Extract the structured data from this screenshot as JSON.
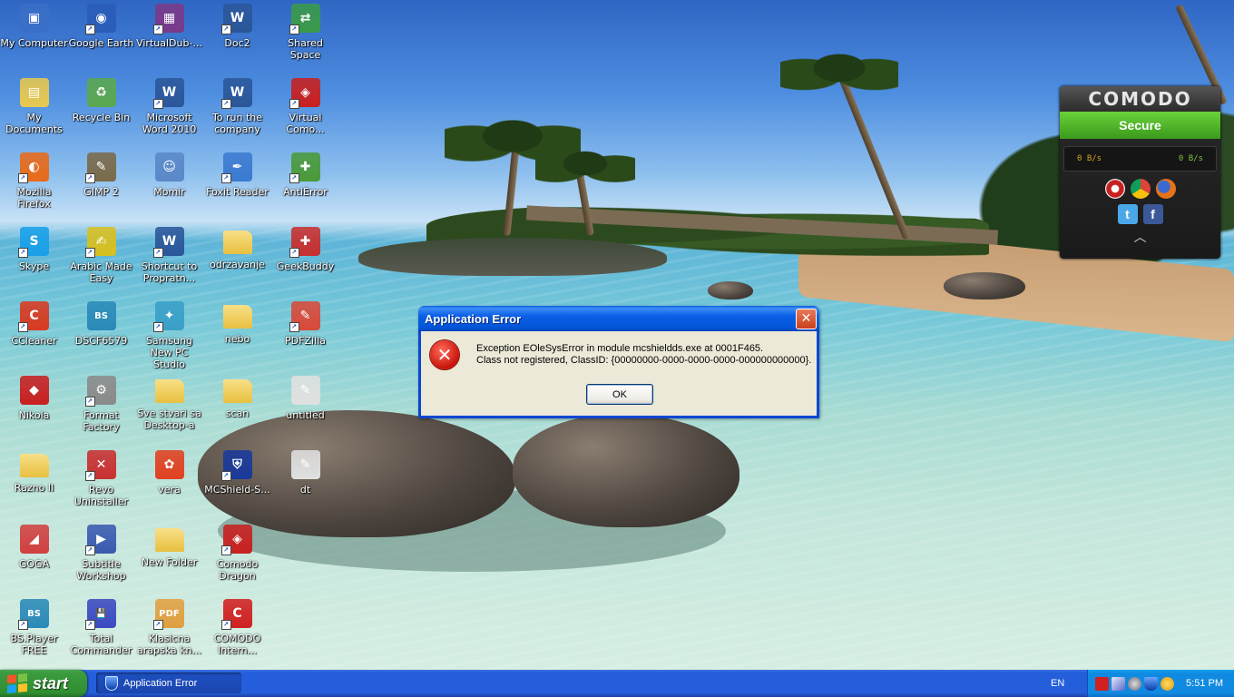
{
  "desktop": {
    "icons": [
      {
        "label": "My Computer",
        "icon": "my-computer-icon",
        "color": "#3a6fc8",
        "glyph": "▣",
        "shortcut": false
      },
      {
        "label": "Google Earth",
        "icon": "google-earth-icon",
        "color": "#2a5db8",
        "glyph": "◉",
        "shortcut": true
      },
      {
        "label": "VirtualDub-...",
        "icon": "virtualdub-icon",
        "color": "#7a3a8a",
        "glyph": "▦",
        "shortcut": true
      },
      {
        "label": "Doc2",
        "icon": "word-document-icon",
        "color": "#2b579a",
        "glyph": "W",
        "shortcut": true
      },
      {
        "label": "Shared Space",
        "icon": "shared-space-icon",
        "color": "#3a9a4a",
        "glyph": "⇄",
        "shortcut": true
      },
      {
        "label": "My Documents",
        "icon": "my-documents-icon",
        "color": "#e8c850",
        "glyph": "▤",
        "shortcut": false
      },
      {
        "label": "Recycle Bin",
        "icon": "recycle-bin-icon",
        "color": "#5aa850",
        "glyph": "♻",
        "shortcut": false
      },
      {
        "label": "Microsoft Word 2010",
        "icon": "word-icon",
        "color": "#2b579a",
        "glyph": "W",
        "shortcut": true
      },
      {
        "label": "To run the company",
        "icon": "word-document-icon",
        "color": "#2b579a",
        "glyph": "W",
        "shortcut": true
      },
      {
        "label": "Virtual Como...",
        "icon": "comodo-virtual-icon",
        "color": "#c82020",
        "glyph": "◈",
        "shortcut": true
      },
      {
        "label": "Mozilla Firefox",
        "icon": "firefox-icon",
        "color": "#e86a1a",
        "glyph": "◐",
        "shortcut": true
      },
      {
        "label": "GIMP 2",
        "icon": "gimp-icon",
        "color": "#7a6a4a",
        "glyph": "✎",
        "shortcut": true
      },
      {
        "label": "Momir",
        "icon": "user-folder-icon",
        "color": "#5a88c8",
        "glyph": "☺",
        "shortcut": false
      },
      {
        "label": "Foxit Reader",
        "icon": "foxit-reader-icon",
        "color": "#3a7ad0",
        "glyph": "✒",
        "shortcut": true
      },
      {
        "label": "AntiError",
        "icon": "antierror-icon",
        "color": "#4a9a3a",
        "glyph": "✚",
        "shortcut": true
      },
      {
        "label": "Skype",
        "icon": "skype-icon",
        "color": "#1aa0e8",
        "glyph": "S",
        "shortcut": true
      },
      {
        "label": "Arabic Made Easy",
        "icon": "arabic-made-easy-icon",
        "color": "#d8c020",
        "glyph": "✍",
        "shortcut": true
      },
      {
        "label": "Shortcut to Propratn...",
        "icon": "word-document-icon",
        "color": "#2b579a",
        "glyph": "W",
        "shortcut": true
      },
      {
        "label": "odrzavanje",
        "icon": "folder-icon",
        "color": "#f0d060",
        "glyph": "",
        "shortcut": false
      },
      {
        "label": "GeekBuddy",
        "icon": "geekbuddy-icon",
        "color": "#c83030",
        "glyph": "✚",
        "shortcut": true
      },
      {
        "label": "CCleaner",
        "icon": "ccleaner-icon",
        "color": "#d83a20",
        "glyph": "C",
        "shortcut": true
      },
      {
        "label": "DSCF6579",
        "icon": "bsplayer-file-icon",
        "color": "#2a8ab8",
        "glyph": "BS",
        "shortcut": false
      },
      {
        "label": "Samsung New PC Studio",
        "icon": "samsung-pc-studio-icon",
        "color": "#3aa0c8",
        "glyph": "✦",
        "shortcut": true
      },
      {
        "label": "nebo",
        "icon": "folder-icon",
        "color": "#f0d060",
        "glyph": "",
        "shortcut": false
      },
      {
        "label": "PDFZilla",
        "icon": "pdfzilla-icon",
        "color": "#d84a3a",
        "glyph": "✎",
        "shortcut": true
      },
      {
        "label": "Nikola",
        "icon": "car-image-icon",
        "color": "#c82020",
        "glyph": "◆",
        "shortcut": false
      },
      {
        "label": "Format Factory",
        "icon": "format-factory-icon",
        "color": "#8a8a8a",
        "glyph": "⚙",
        "shortcut": true
      },
      {
        "label": "Sve stvari sa Desktop-a",
        "icon": "folder-icon",
        "color": "#f0d060",
        "glyph": "",
        "shortcut": false
      },
      {
        "label": "scan",
        "icon": "folder-icon",
        "color": "#f0d060",
        "glyph": "",
        "shortcut": false
      },
      {
        "label": "untitled",
        "icon": "paint-file-icon",
        "color": "#e0e0e0",
        "glyph": "✎",
        "shortcut": false
      },
      {
        "label": "Razno II",
        "icon": "folder-icon",
        "color": "#f0d060",
        "glyph": "",
        "shortcut": false
      },
      {
        "label": "Revo Uninstaller",
        "icon": "revo-uninstaller-icon",
        "color": "#c83030",
        "glyph": "✕",
        "shortcut": true
      },
      {
        "label": "vera",
        "icon": "flower-image-icon",
        "color": "#e04020",
        "glyph": "✿",
        "shortcut": false
      },
      {
        "label": "MCShield-S...",
        "icon": "mcshield-icon",
        "color": "#1a3a9a",
        "glyph": "⛨",
        "shortcut": true
      },
      {
        "label": "dt",
        "icon": "paint-file-icon",
        "color": "#e0e0e0",
        "glyph": "✎",
        "shortcut": false
      },
      {
        "label": "GOGA",
        "icon": "shoe-image-icon",
        "color": "#d04040",
        "glyph": "◢",
        "shortcut": false
      },
      {
        "label": "Subtitle Workshop",
        "icon": "subtitle-workshop-icon",
        "color": "#3a5ab0",
        "glyph": "▶",
        "shortcut": true
      },
      {
        "label": "New Folder",
        "icon": "folder-icon",
        "color": "#f0d060",
        "glyph": "",
        "shortcut": false
      },
      {
        "label": "Comodo Dragon",
        "icon": "comodo-dragon-icon",
        "color": "#c82020",
        "glyph": "◈",
        "shortcut": true
      },
      {
        "label": "",
        "icon": "",
        "color": "",
        "glyph": "",
        "shortcut": false
      },
      {
        "label": "BS.Player FREE",
        "icon": "bsplayer-icon",
        "color": "#2a8ab8",
        "glyph": "BS",
        "shortcut": true
      },
      {
        "label": "Total Commander",
        "icon": "total-commander-icon",
        "color": "#3a4ac0",
        "glyph": "💾",
        "shortcut": true
      },
      {
        "label": "Klasicna arapska kn...",
        "icon": "pdf-file-icon",
        "color": "#e0a040",
        "glyph": "PDF",
        "shortcut": true
      },
      {
        "label": "COMODO Intern...",
        "icon": "comodo-internet-security-icon",
        "color": "#d02020",
        "glyph": "C",
        "shortcut": true
      }
    ]
  },
  "comodo_widget": {
    "logo": "COMODO",
    "status": "Secure",
    "download_speed": "0 B/s",
    "upload_speed": "0 B/s",
    "colors": {
      "status": "#4caf2a",
      "down": "#d6a420",
      "up": "#7bc242"
    }
  },
  "dialog": {
    "title": "Application Error",
    "message_line1": "Exception EOleSysError in module mcshieldds.exe at 0001F465.",
    "message_line2": "Class not registered, ClassID: {00000000-0000-0000-0000-000000000000}.",
    "ok_label": "OK",
    "close_glyph": "✕",
    "error_glyph": "✕"
  },
  "taskbar": {
    "start_label": "start",
    "task_label": "Application Error",
    "language": "EN",
    "clock": "5:51 PM"
  }
}
